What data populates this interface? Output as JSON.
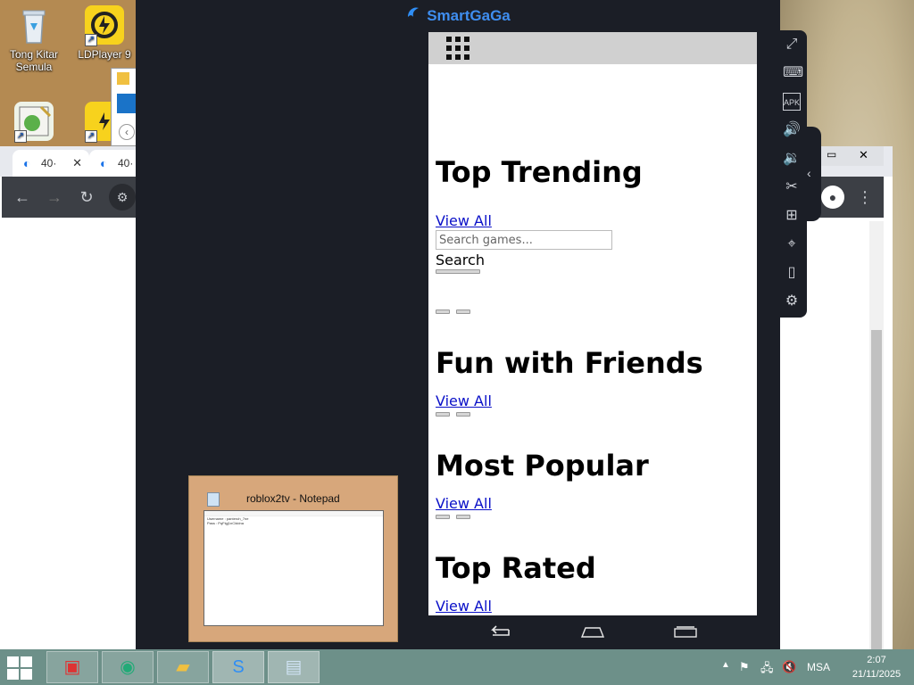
{
  "desktop": {
    "icons": [
      {
        "label": "Tong Kitar Semula",
        "icon": "recycle-bin-icon"
      },
      {
        "label": "LDPlayer 9",
        "icon": "ldplayer-icon"
      },
      {
        "label": "",
        "icon": "cheat-engine-icon"
      },
      {
        "label": "",
        "icon": "ldplayer-multi-icon"
      }
    ]
  },
  "browser": {
    "tabs": [
      {
        "label": "40·",
        "icon": "loading-icon"
      },
      {
        "label": "40·",
        "icon": "loading-icon"
      }
    ],
    "toolbar_icons": [
      "back-icon",
      "forward-icon",
      "reload-icon",
      "site-settings-icon",
      "profile-icon",
      "more-icon"
    ]
  },
  "emulator": {
    "title": "SmartGaGa",
    "side_icons": [
      "fullscreen-icon",
      "keyboard-icon",
      "apk-install-icon",
      "volume-up-icon",
      "volume-down-icon",
      "scissors-icon",
      "add-window-icon",
      "location-icon",
      "shake-icon",
      "settings-icon"
    ],
    "nav_icons": [
      "back-icon",
      "home-icon",
      "recent-apps-icon"
    ]
  },
  "page": {
    "sections": [
      {
        "title": "Top Trending",
        "link": "View All"
      },
      {
        "title": "Fun with Friends",
        "link": "View All"
      },
      {
        "title": "Most Popular",
        "link": "View All"
      },
      {
        "title": "Top Rated",
        "link": "View All"
      }
    ],
    "search": {
      "placeholder": "Search games...",
      "button": "Search"
    }
  },
  "notepad_preview": {
    "title": "roblox2tv - Notepad",
    "lines": [
      "Username : panteroh_7ne",
      "Pass : PqFtgj1nClddna"
    ]
  },
  "taskbar": {
    "apps": [
      "toolbox-icon",
      "browser-globe-icon",
      "file-explorer-icon",
      "smartgaga-icon",
      "notepad-icon"
    ],
    "tray": {
      "language": "MSA",
      "time": "2:07",
      "date": "21/11/2025"
    }
  }
}
